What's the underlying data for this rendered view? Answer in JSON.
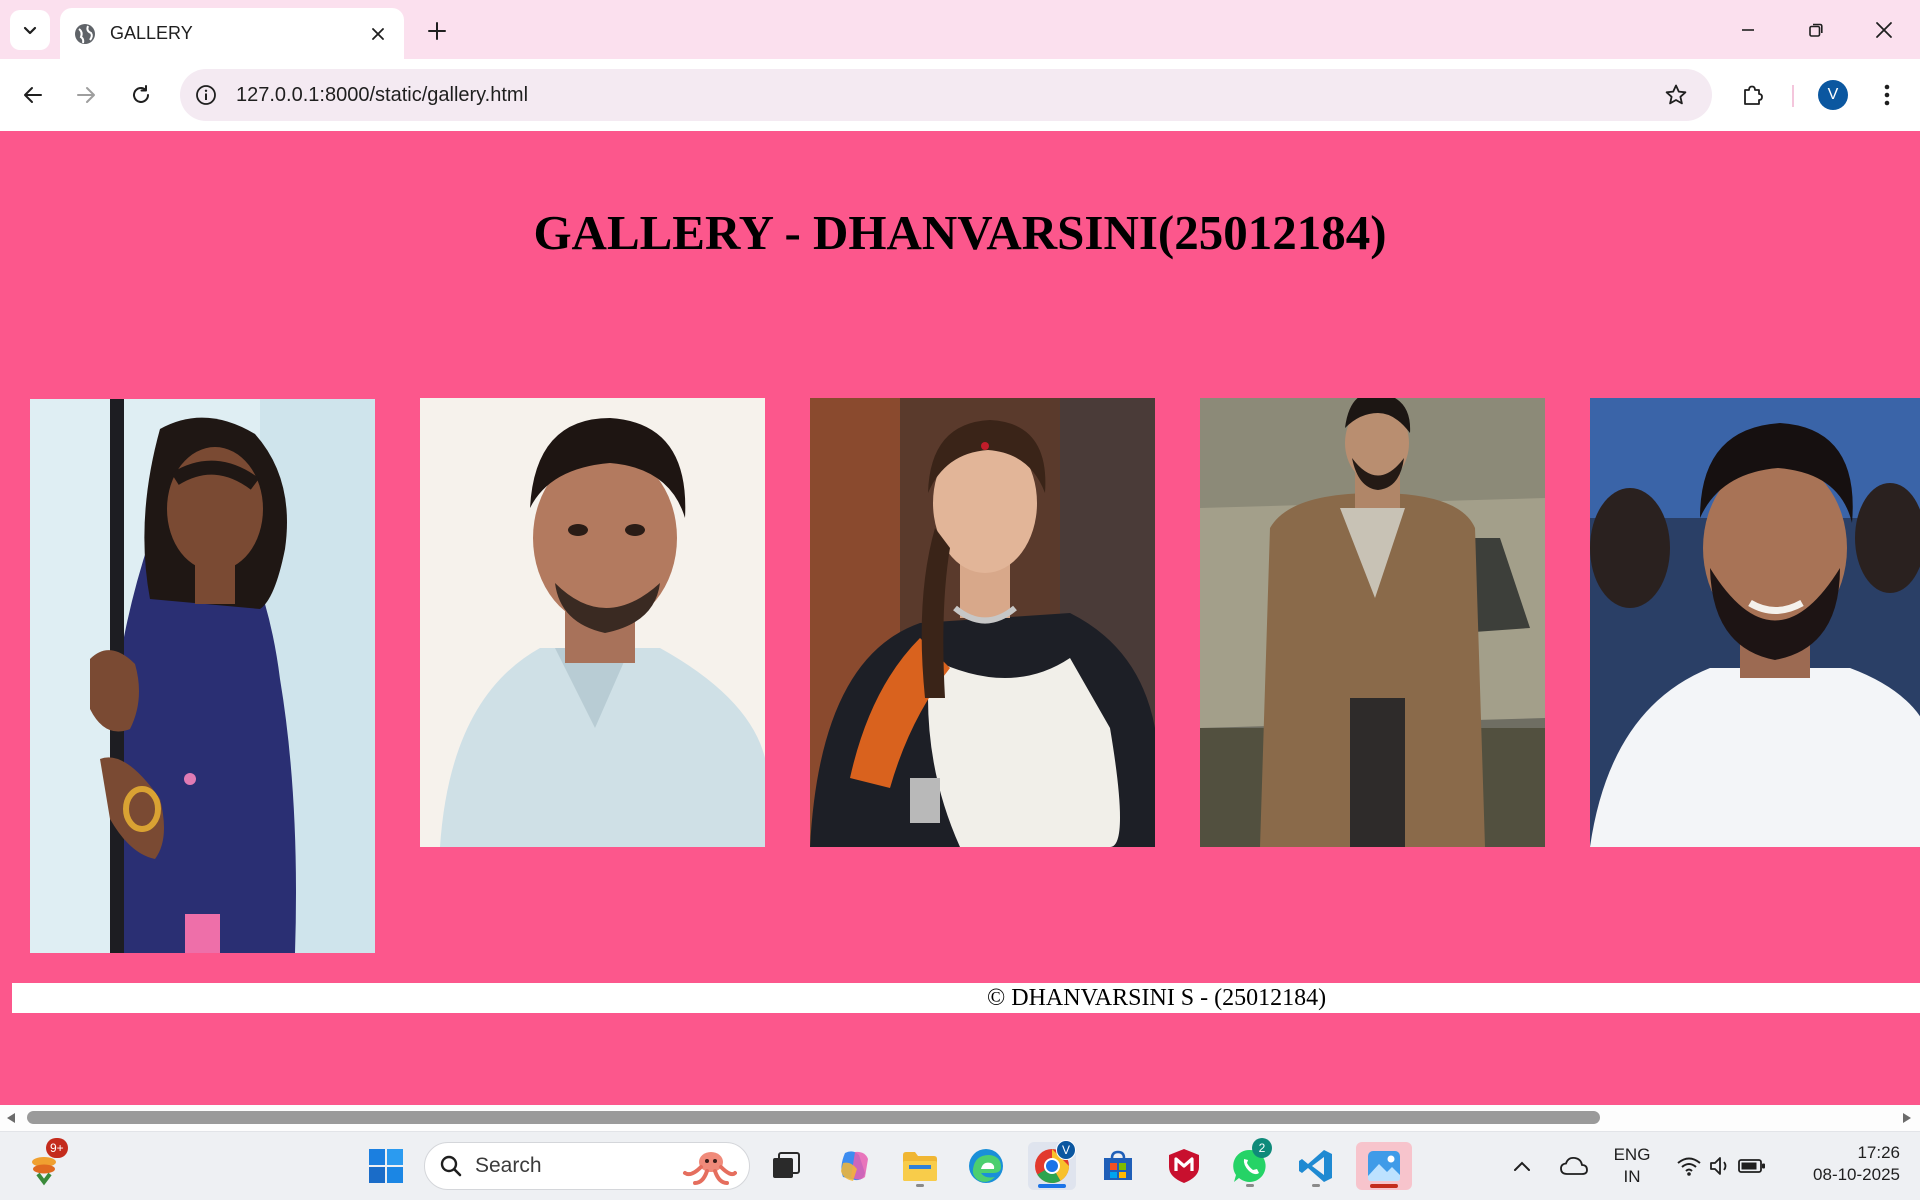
{
  "browser": {
    "tab_title": "GALLERY",
    "url": "127.0.0.1:8000/static/gallery.html",
    "profile_initial": "V"
  },
  "page": {
    "heading": "GALLERY - DHANVARSINI(25012184)",
    "footer": "© DHANVARSINI S - (25012184)",
    "background": "#fc578c",
    "images": [
      {
        "alt": "portrait-girl-holding-pole"
      },
      {
        "alt": "portrait-man-light-shirt"
      },
      {
        "alt": "portrait-woman-saree"
      },
      {
        "alt": "portrait-man-trench-coat-car"
      },
      {
        "alt": "portrait-man-white-shirt-smiling"
      }
    ]
  },
  "taskbar": {
    "widgets_badge": "9+",
    "search_placeholder": "Search",
    "whatsapp_badge": "2",
    "chrome_profile_badge": "V",
    "language_line1": "ENG",
    "language_line2": "IN",
    "time": "17:26",
    "date": "08-10-2025"
  },
  "colors": {
    "accent_blue": "#0b57a0",
    "tab_strip": "#fbe0ee",
    "omnibox": "#f4eaf2",
    "taskbar": "#eef0f3"
  }
}
